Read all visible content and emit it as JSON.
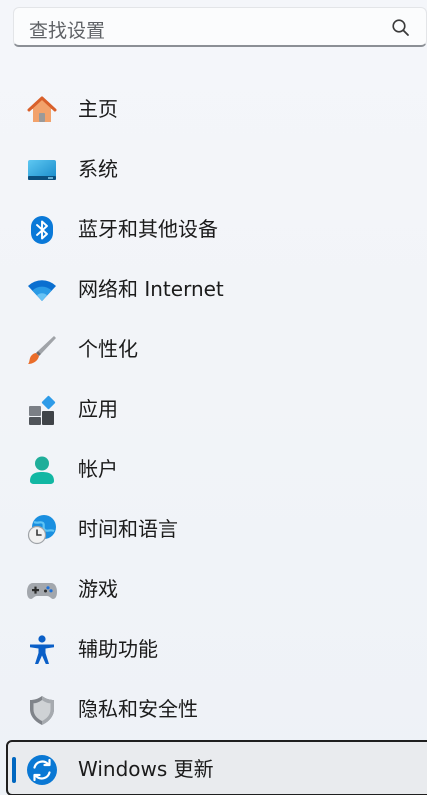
{
  "search": {
    "placeholder": "查找设置"
  },
  "nav": {
    "items": [
      {
        "label": "主页",
        "icon": "home-icon"
      },
      {
        "label": "系统",
        "icon": "system-icon"
      },
      {
        "label": "蓝牙和其他设备",
        "icon": "bluetooth-icon"
      },
      {
        "label": "网络和 Internet",
        "icon": "wifi-icon"
      },
      {
        "label": "个性化",
        "icon": "paintbrush-icon"
      },
      {
        "label": "应用",
        "icon": "apps-icon"
      },
      {
        "label": "帐户",
        "icon": "account-icon"
      },
      {
        "label": "时间和语言",
        "icon": "globe-clock-icon"
      },
      {
        "label": "游戏",
        "icon": "gamepad-icon"
      },
      {
        "label": "辅助功能",
        "icon": "accessibility-icon"
      },
      {
        "label": "隐私和安全性",
        "icon": "shield-icon"
      },
      {
        "label": "Windows 更新",
        "icon": "windows-update-icon",
        "selected": true
      }
    ]
  },
  "colors": {
    "accent": "#0067c0",
    "background": "#f3f5f9"
  }
}
